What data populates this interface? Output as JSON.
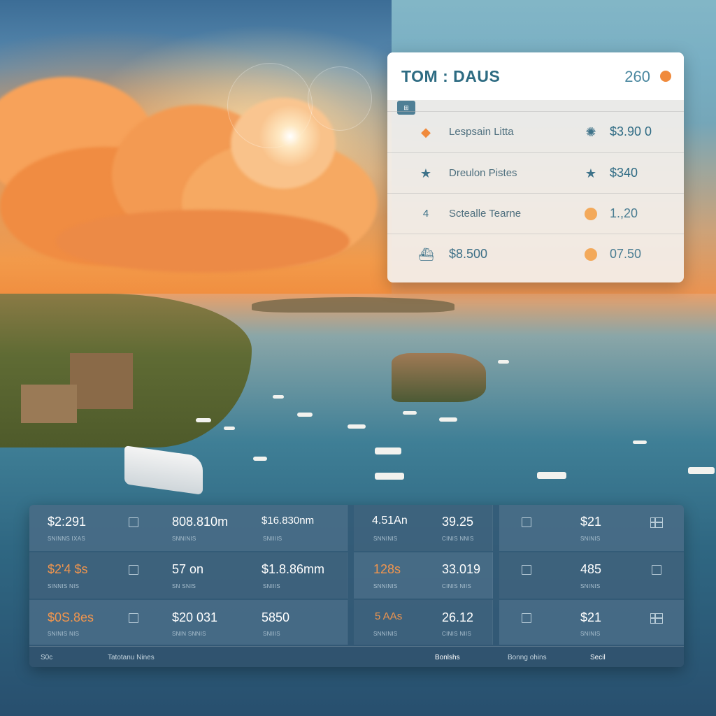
{
  "card": {
    "title": "TOM : DAUS",
    "count": "260",
    "tag": "⊞",
    "rows": [
      {
        "icon": "diamond-icon",
        "label": "Lespsain Litta",
        "icon2": "crab-icon",
        "value": "$3.90 0"
      },
      {
        "icon": "star-icon",
        "label": "Dreulon Pistes",
        "icon2": "star-icon",
        "value": "$340"
      },
      {
        "icon": "number-icon",
        "icon_text": "4",
        "label": "Sctealle Tearne",
        "icon2": "orange-dot-icon",
        "value": "1.,20"
      },
      {
        "icon": "boat-icon",
        "label": "$8.500",
        "icon2": "orange-dot-icon",
        "value": "07.50"
      }
    ]
  },
  "panel": {
    "rows": [
      {
        "c1": {
          "value": "$2:291",
          "sub": "SNINNS IXAS"
        },
        "c2": {
          "value": "808.810m",
          "sub": "SNNINIS"
        },
        "c3": {
          "value": "$16.830nm",
          "sub": "SNIIIIS"
        },
        "c4": {
          "value": "4.51An",
          "sub": "SNNINIS"
        },
        "c5": {
          "value": "39.25",
          "sub": "CINIS NNIS"
        },
        "c6": {
          "value": "$21",
          "sub": "SNINIS"
        }
      },
      {
        "c1": {
          "value": "$2'4 $s",
          "sub": "SINNIS NIS"
        },
        "c2": {
          "value": "57 on",
          "sub": "SN SNIS"
        },
        "c3": {
          "value": "$1.8.86mm",
          "sub": "SNIIIS"
        },
        "c4": {
          "value": "128s",
          "sub": "SNNINIS"
        },
        "c5": {
          "value": "33.019",
          "sub": "CINIS NIIS"
        },
        "c6": {
          "value": "485",
          "sub": "SNINIS"
        }
      },
      {
        "c1": {
          "value": "$0S.8es",
          "sub": "SNINIS NIS"
        },
        "c2": {
          "value": "$20 031",
          "sub": "SNIN SNNIS"
        },
        "c3": {
          "value": "5850",
          "sub": "SNIIIS"
        },
        "c4": {
          "value": "5 AAs",
          "sub": "SNNINIS"
        },
        "c5": {
          "value": "26.12",
          "sub": "CINIS NIIS"
        },
        "c6": {
          "value": "$21",
          "sub": "SNINIS"
        }
      }
    ],
    "footer": {
      "left": "S0c",
      "label": "Tatotanu Nines",
      "item1": "Bonlshs",
      "item2": "Bonng ohins",
      "item3": "Secil"
    }
  },
  "colors": {
    "accent_orange": "#f08a3c",
    "card_title": "#2d6b82",
    "panel_bg": "#345874"
  }
}
